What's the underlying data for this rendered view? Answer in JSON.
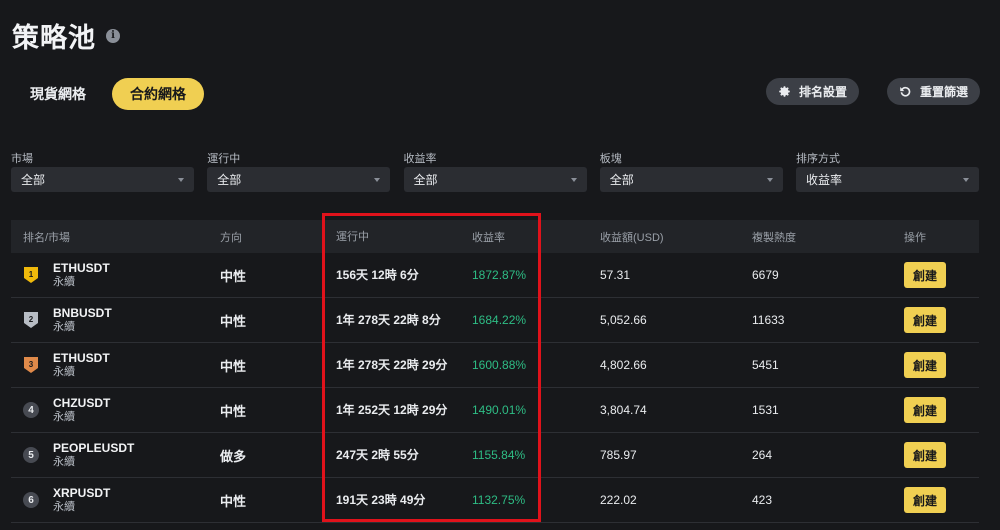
{
  "page": {
    "title": "策略池",
    "info_icon": "info-icon"
  },
  "tabs": [
    {
      "label": "現貨網格",
      "active": false
    },
    {
      "label": "合約網格",
      "active": true
    }
  ],
  "actions": {
    "rank_settings": "排名設置",
    "reset_filters": "重置篩選"
  },
  "filters": [
    {
      "label": "市場",
      "value": "全部"
    },
    {
      "label": "運行中",
      "value": "全部"
    },
    {
      "label": "收益率",
      "value": "全部"
    },
    {
      "label": "板塊",
      "value": "全部"
    },
    {
      "label": "排序方式",
      "value": "收益率"
    }
  ],
  "table": {
    "headers": [
      "排名/市場",
      "方向",
      "運行中",
      "收益率",
      "收益額(USD)",
      "複製熱度",
      "操作"
    ],
    "rows": [
      {
        "rank": "1",
        "badge": "gold",
        "pair": "ETHUSDT",
        "type": "永續",
        "direction": "中性",
        "runtime": "156天 12時 6分",
        "roi": "1872.87%",
        "profit": "57.31",
        "heat": "6679",
        "action": "創建"
      },
      {
        "rank": "2",
        "badge": "silver",
        "pair": "BNBUSDT",
        "type": "永續",
        "direction": "中性",
        "runtime": "1年 278天 22時 8分",
        "roi": "1684.22%",
        "profit": "5,052.66",
        "heat": "11633",
        "action": "創建"
      },
      {
        "rank": "3",
        "badge": "bronze",
        "pair": "ETHUSDT",
        "type": "永續",
        "direction": "中性",
        "runtime": "1年 278天 22時 29分",
        "roi": "1600.88%",
        "profit": "4,802.66",
        "heat": "5451",
        "action": "創建"
      },
      {
        "rank": "4",
        "badge": "plain",
        "pair": "CHZUSDT",
        "type": "永續",
        "direction": "中性",
        "runtime": "1年 252天 12時 29分",
        "roi": "1490.01%",
        "profit": "3,804.74",
        "heat": "1531",
        "action": "創建"
      },
      {
        "rank": "5",
        "badge": "plain",
        "pair": "PEOPLEUSDT",
        "type": "永續",
        "direction": "做多",
        "runtime": "247天 2時 55分",
        "roi": "1155.84%",
        "profit": "785.97",
        "heat": "264",
        "action": "創建"
      },
      {
        "rank": "6",
        "badge": "plain",
        "pair": "XRPUSDT",
        "type": "永續",
        "direction": "中性",
        "runtime": "191天 23時 49分",
        "roi": "1132.75%",
        "profit": "222.02",
        "heat": "423",
        "action": "創建"
      }
    ]
  },
  "colors": {
    "accent": "#f0cf52",
    "positive": "#2ebd85",
    "highlight": "#e0121b",
    "gold": "#f0b90b",
    "silver": "#b7bcc4",
    "bronze": "#e08a4a"
  }
}
